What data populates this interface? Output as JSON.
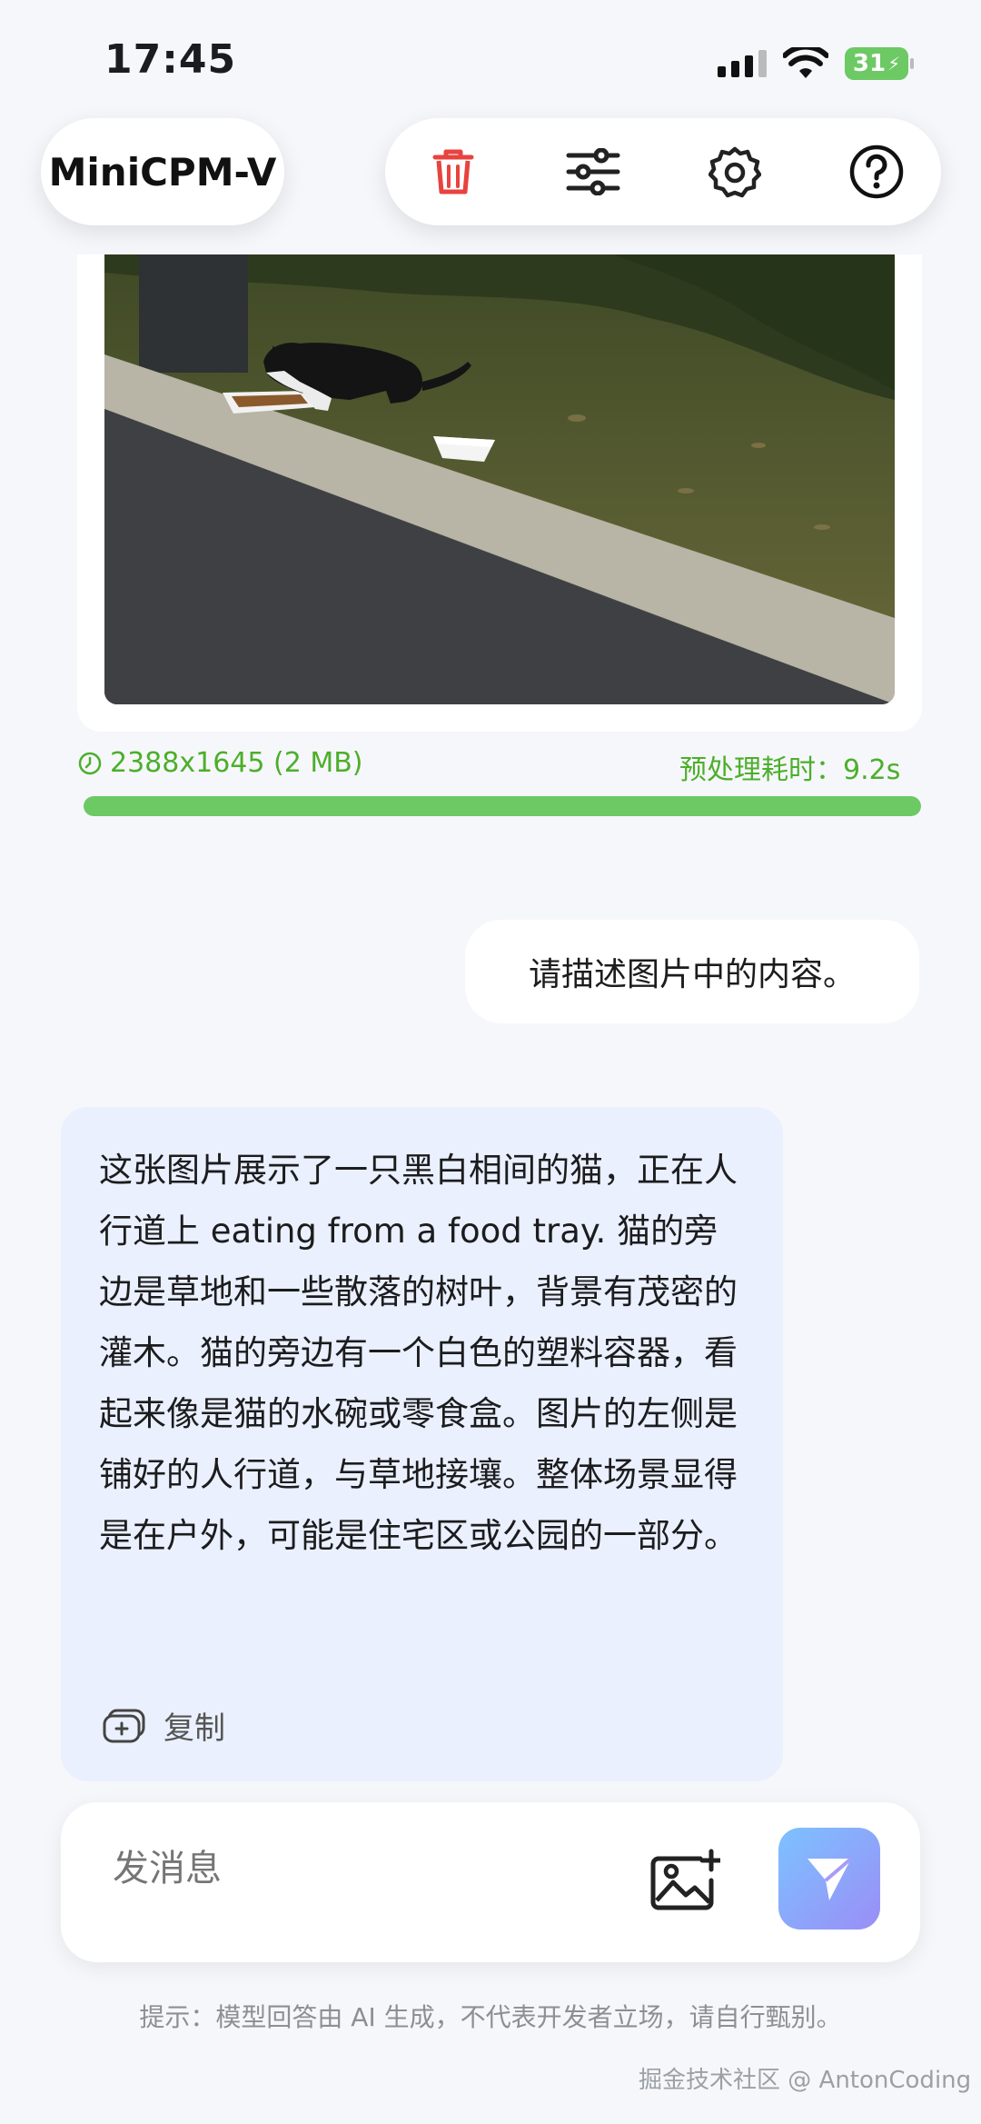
{
  "status_bar": {
    "time": "17:45",
    "battery": "31"
  },
  "header": {
    "app_name": "MiniCPM-V",
    "icons": [
      "trash-icon",
      "sliders-icon",
      "gear-icon",
      "help-icon"
    ]
  },
  "image_info": {
    "dimensions": "2388x1645 (2 MB)",
    "preprocess_time": "预处理耗时：9.2s",
    "progress": 1.0
  },
  "messages": {
    "user": "请描述图片中的内容。",
    "assistant": "这张图片展示了一只黑白相间的猫，正在人行道上 eating from a food tray. 猫的旁边是草地和一些散落的树叶，背景有茂密的灌木。猫的旁边有一个白色的塑料容器，看起来像是猫的水碗或零食盒。图片的左侧是铺好的人行道，与草地接壤。整体场景显得是在户外，可能是住宅区或公园的一部分。",
    "copy_label": "复制"
  },
  "composer": {
    "placeholder": "发消息"
  },
  "disclaimer": "提示：模型回答由 AI 生成，不代表开发者立场，请自行甄别。",
  "watermark": "掘金技术社区 @ AntonCoding",
  "colors": {
    "accent_green": "#6cc964",
    "trash_red": "#e8433f",
    "bubble_blue": "#eaf0fd"
  }
}
